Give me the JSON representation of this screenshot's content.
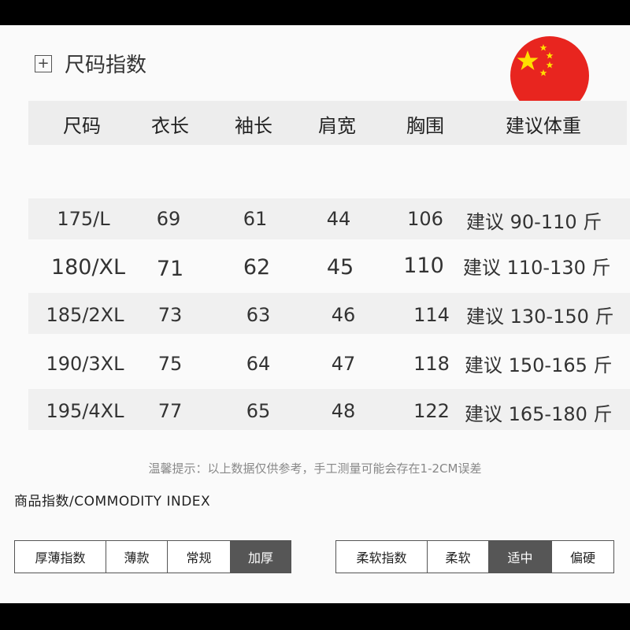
{
  "section": {
    "title": "尺码指数",
    "expand_symbol": "+"
  },
  "flag_icon": "china-flag-icon",
  "table": {
    "headers": [
      "尺码",
      "衣长",
      "袖长",
      "肩宽",
      "胸围",
      "建议体重"
    ],
    "rows": [
      [
        "175/L",
        "69",
        "61",
        "44",
        "106",
        "建议 90-110 斤"
      ],
      [
        "180/XL",
        "71",
        "62",
        "45",
        "110",
        "建议 110-130 斤"
      ],
      [
        "185/2XL",
        "73",
        "63",
        "46",
        "114",
        "建议 130-150 斤"
      ],
      [
        "190/3XL",
        "75",
        "64",
        "47",
        "118",
        "建议 150-165 斤"
      ],
      [
        "195/4XL",
        "77",
        "65",
        "48",
        "122",
        "建议 165-180 斤"
      ]
    ]
  },
  "note": "温馨提示：以上数据仅供参考，手工测量可能会存在1-2CM误差",
  "commodity_title": "商品指数/COMMODITY INDEX",
  "thickness": {
    "label": "厚薄指数",
    "options": [
      "薄款",
      "常规",
      "加厚"
    ],
    "selected": "加厚"
  },
  "softness": {
    "label": "柔软指数",
    "options": [
      "柔软",
      "适中",
      "偏硬"
    ],
    "selected": "适中"
  },
  "colors": {
    "flag_red": "#e8251f",
    "flag_star": "#ffde00",
    "active_bg": "#565656"
  }
}
